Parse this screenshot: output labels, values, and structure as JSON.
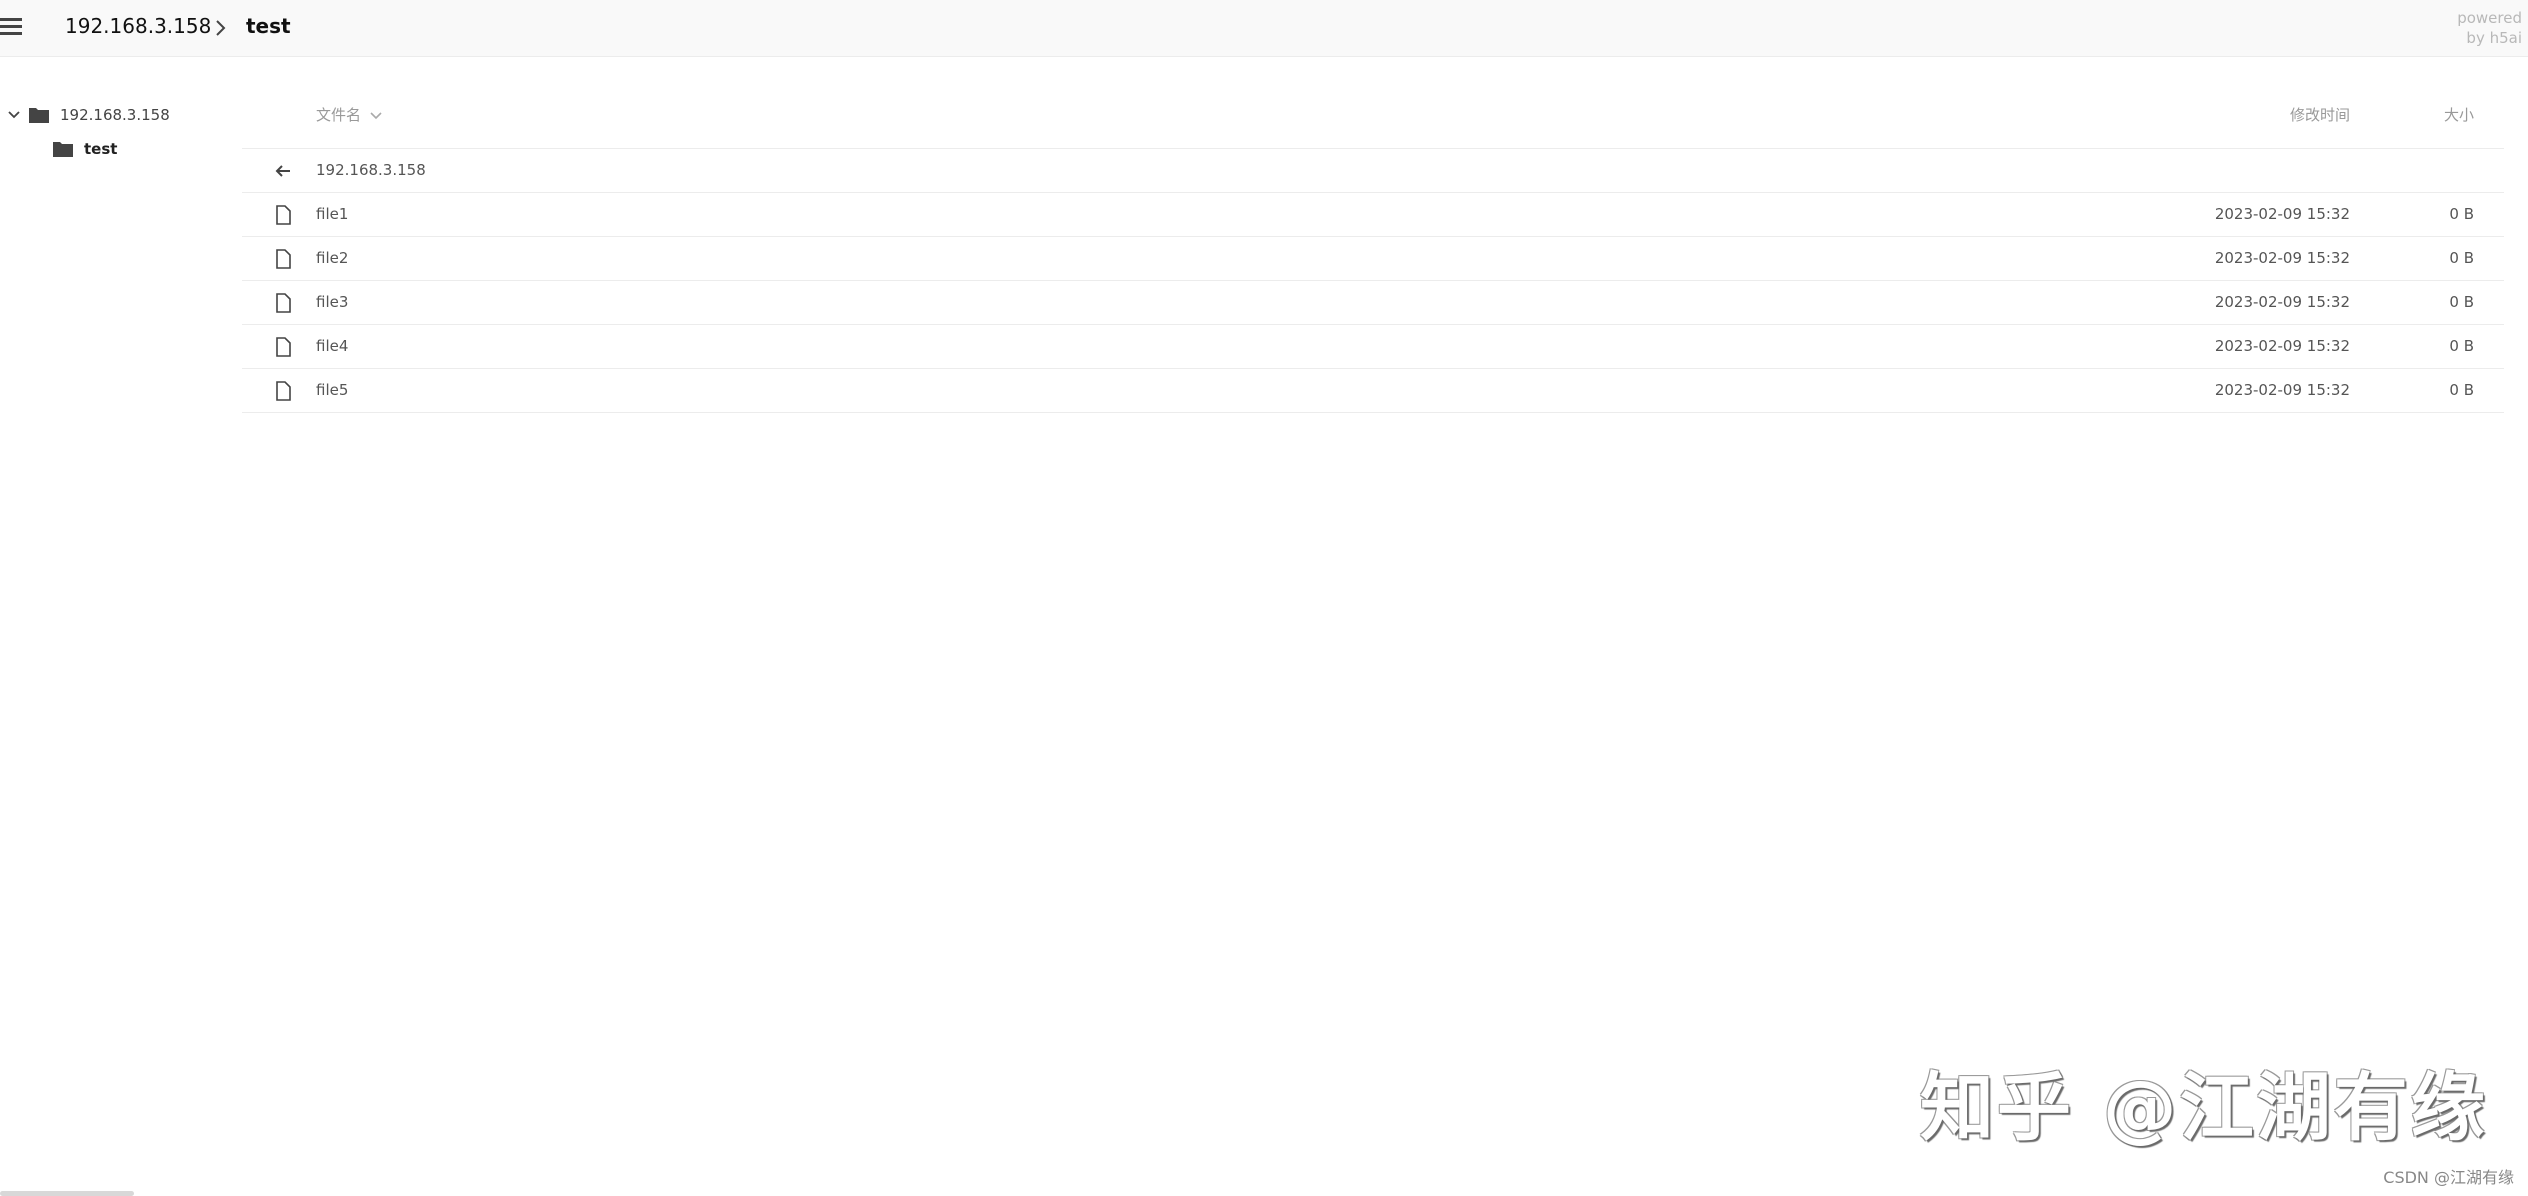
{
  "header": {
    "breadcrumb_host": "192.168.3.158",
    "breadcrumb_current": "test",
    "powered_line1": "powered",
    "powered_line2": "by h5ai"
  },
  "sidebar": {
    "root_label": "192.168.3.158",
    "child_label": "test"
  },
  "listing": {
    "col_name": "文件名",
    "col_date": "修改时间",
    "col_size": "大小",
    "parent_label": "192.168.3.158",
    "files": [
      {
        "name": "file1",
        "date": "2023-02-09 15:32",
        "size": "0 B"
      },
      {
        "name": "file2",
        "date": "2023-02-09 15:32",
        "size": "0 B"
      },
      {
        "name": "file3",
        "date": "2023-02-09 15:32",
        "size": "0 B"
      },
      {
        "name": "file4",
        "date": "2023-02-09 15:32",
        "size": "0 B"
      },
      {
        "name": "file5",
        "date": "2023-02-09 15:32",
        "size": "0 B"
      }
    ]
  },
  "watermark": {
    "main": "知乎 @江湖有缘",
    "footer": "CSDN @江湖有缘"
  },
  "icons": [
    "menu-icon",
    "chevron-right-icon",
    "chevron-down-icon",
    "folder-icon",
    "sort-chevron-icon",
    "back-arrow-icon",
    "file-icon"
  ]
}
